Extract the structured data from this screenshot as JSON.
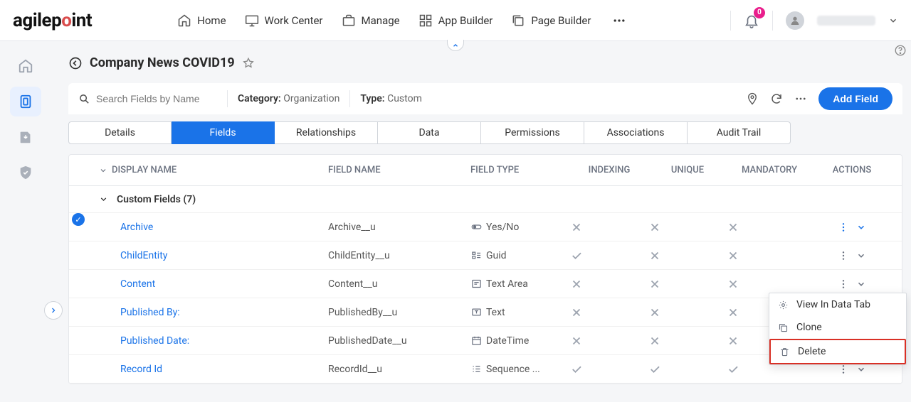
{
  "brand": "agilepoint",
  "nav": {
    "home": "Home",
    "workcenter": "Work Center",
    "manage": "Manage",
    "appbuilder": "App Builder",
    "pagebuilder": "Page Builder"
  },
  "notifications": "0",
  "page": {
    "title": "Company News COVID19"
  },
  "toolbar": {
    "search_placeholder": "Search Fields by Name",
    "category_label": "Category:",
    "category_value": "Organization",
    "type_label": "Type:",
    "type_value": "Custom",
    "add_field": "Add Field"
  },
  "tabs": [
    "Details",
    "Fields",
    "Relationships",
    "Data",
    "Permissions",
    "Associations",
    "Audit Trail"
  ],
  "active_tab": 1,
  "columns": {
    "display": "DISPLAY NAME",
    "field": "FIELD NAME",
    "type": "FIELD TYPE",
    "indexing": "INDEXING",
    "unique": "UNIQUE",
    "mandatory": "MANDATORY",
    "actions": "ACTIONS"
  },
  "group": "Custom Fields (7)",
  "rows": [
    {
      "display": "Archive",
      "field": "Archive__u",
      "type": "Yes/No",
      "type_icon": "toggle",
      "indexing": false,
      "unique": false,
      "mandatory": false,
      "selected": true,
      "menu_open": true
    },
    {
      "display": "ChildEntity",
      "field": "ChildEntity__u",
      "type": "Guid",
      "type_icon": "guid",
      "indexing": true,
      "unique": false,
      "mandatory": false
    },
    {
      "display": "Content",
      "field": "Content__u",
      "type": "Text Area",
      "type_icon": "textarea",
      "indexing": false,
      "unique": false,
      "mandatory": false
    },
    {
      "display": "Published By:",
      "field": "PublishedBy__u",
      "type": "Text",
      "type_icon": "text",
      "indexing": false,
      "unique": false,
      "mandatory": false
    },
    {
      "display": "Published Date:",
      "field": "PublishedDate__u",
      "type": "DateTime",
      "type_icon": "datetime",
      "indexing": false,
      "unique": false,
      "mandatory": false
    },
    {
      "display": "Record Id",
      "field": "RecordId__u",
      "type": "Sequence ...",
      "type_icon": "sequence",
      "indexing": true,
      "unique": true,
      "mandatory": true
    }
  ],
  "ctx": {
    "view": "View In Data Tab",
    "clone": "Clone",
    "delete": "Delete"
  }
}
